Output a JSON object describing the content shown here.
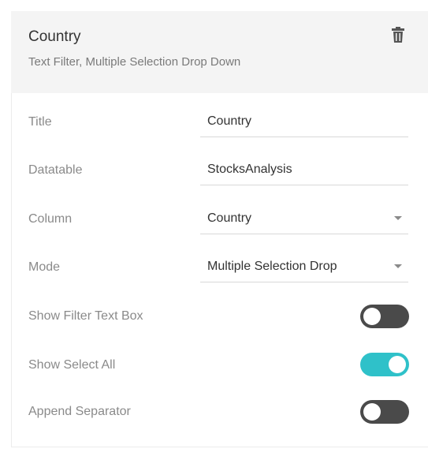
{
  "header": {
    "title": "Country",
    "subtitle": "Text Filter, Multiple Selection Drop Down",
    "delete_icon": "trash-icon"
  },
  "fields": {
    "title": {
      "label": "Title",
      "value": "Country"
    },
    "datatable": {
      "label": "Datatable",
      "value": "StocksAnalysis"
    },
    "column": {
      "label": "Column",
      "value": "Country"
    },
    "mode": {
      "label": "Mode",
      "value": "Multiple Selection Drop"
    }
  },
  "toggles": {
    "show_filter_text_box": {
      "label": "Show Filter Text Box",
      "on": false
    },
    "show_select_all": {
      "label": "Show Select All",
      "on": true
    },
    "append_separator": {
      "label": "Append Separator",
      "on": false
    }
  },
  "colors": {
    "toggle_on": "#2fc1c9",
    "toggle_off": "#4a4a4a",
    "header_bg": "#f4f4f4"
  }
}
